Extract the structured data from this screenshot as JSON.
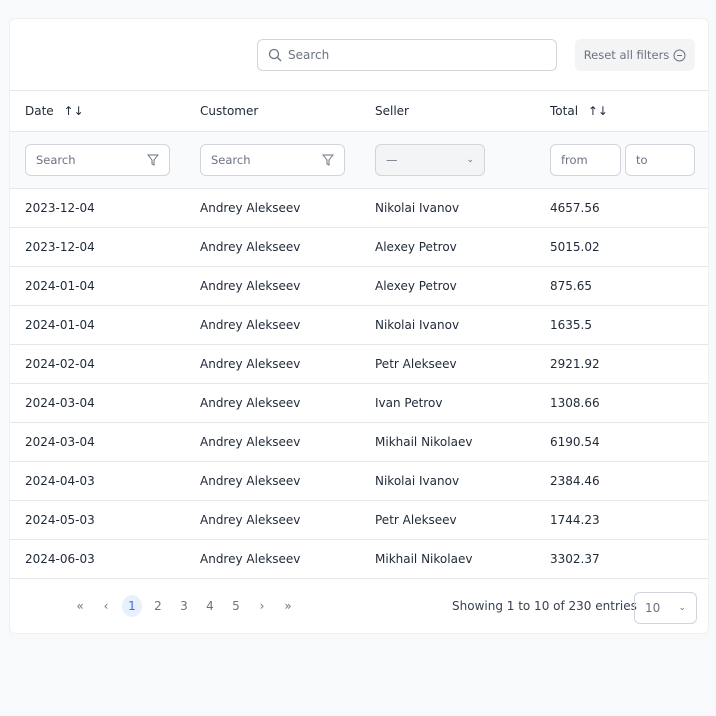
{
  "toolbar": {
    "search_placeholder": "Search",
    "reset_label": "Reset all filters"
  },
  "columns": [
    {
      "label": "Date",
      "sort": "↑↓"
    },
    {
      "label": "Customer"
    },
    {
      "label": "Seller"
    },
    {
      "label": "Total",
      "sort": "↑↓"
    }
  ],
  "filters": {
    "date_placeholder": "Search",
    "customer_placeholder": "Search",
    "seller_value": "—",
    "total_from": "from",
    "total_to": "to"
  },
  "rows": [
    [
      "2023-12-04",
      "Andrey Alekseev",
      "Nikolai Ivanov",
      "4657.56"
    ],
    [
      "2023-12-04",
      "Andrey Alekseev",
      "Alexey Petrov",
      "5015.02"
    ],
    [
      "2024-01-04",
      "Andrey Alekseev",
      "Alexey Petrov",
      "875.65"
    ],
    [
      "2024-01-04",
      "Andrey Alekseev",
      "Nikolai Ivanov",
      "1635.5"
    ],
    [
      "2024-02-04",
      "Andrey Alekseev",
      "Petr Alekseev",
      "2921.92"
    ],
    [
      "2024-03-04",
      "Andrey Alekseev",
      "Ivan Petrov",
      "1308.66"
    ],
    [
      "2024-03-04",
      "Andrey Alekseev",
      "Mikhail Nikolaev",
      "6190.54"
    ],
    [
      "2024-04-03",
      "Andrey Alekseev",
      "Nikolai Ivanov",
      "2384.46"
    ],
    [
      "2024-05-03",
      "Andrey Alekseev",
      "Petr Alekseev",
      "1744.23"
    ],
    [
      "2024-06-03",
      "Andrey Alekseev",
      "Mikhail Nikolaev",
      "3302.37"
    ]
  ],
  "pagination": {
    "first": "«",
    "prev": "‹",
    "pages": [
      "1",
      "2",
      "3",
      "4",
      "5"
    ],
    "next": "›",
    "last": "»",
    "info": "Showing 1 to 10 of 230 entries",
    "page_size": "10"
  }
}
